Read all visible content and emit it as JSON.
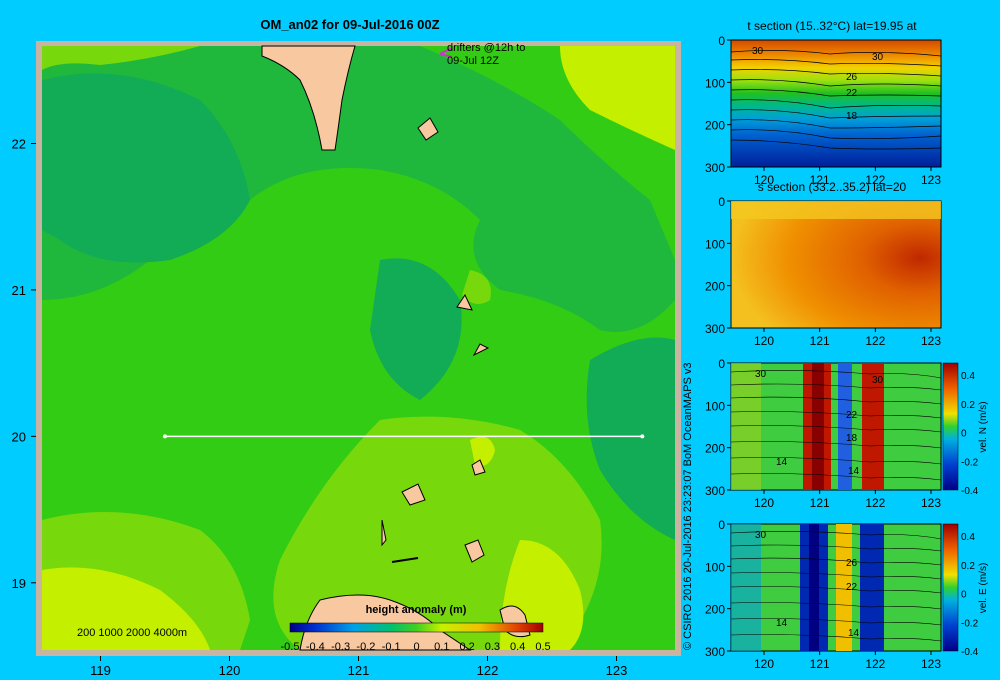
{
  "title": "OM_an02 for 09-Jul-2016 00Z",
  "credit": "© CSIRO 2016  20-Jul-2016 23:23:07 BoM OceanMAPS v3",
  "colors": {
    "background": "#00ccff",
    "land": "#f8c8a0",
    "frame": "#c8b4a0",
    "section_line": "#ffffff",
    "drifter": "#cc33cc"
  },
  "chart_data": [
    {
      "type": "heatmap",
      "name": "map",
      "title": "OM_an02 for 09-Jul-2016 00Z",
      "x_ticks": [
        119,
        120,
        121,
        122,
        123
      ],
      "y_ticks": [
        19,
        20,
        21,
        22
      ],
      "xlim": [
        118.5,
        123.5
      ],
      "ylim": [
        18.5,
        22.7
      ],
      "section_line": {
        "lat": 20,
        "lon_start": 119.5,
        "lon_end": 123.2
      },
      "drifter_note": [
        "drifters @12h to",
        "09-Jul 12Z"
      ],
      "depth_legend": "200  1000  2000  4000m",
      "colorbar": {
        "label": "height anomaly  (m)",
        "ticks": [
          "-0.5",
          "-0.4",
          "-0.3",
          "-0.2",
          "-0.1",
          "0",
          "0.1",
          "0.2",
          "0.3",
          "0.4",
          "0.5"
        ],
        "range": [
          -0.5,
          0.5
        ]
      }
    },
    {
      "type": "heatmap",
      "name": "temperature-section",
      "title": "t section (15..32°C) lat=19.95 at",
      "x_ticks": [
        "120",
        "121",
        "122",
        "123"
      ],
      "y_ticks": [
        "0",
        "100",
        "200",
        "300"
      ],
      "contour_labels": [
        "30",
        "30",
        "26",
        "22",
        "18"
      ]
    },
    {
      "type": "heatmap",
      "name": "salinity-section",
      "title": "s section (33.2..35.2) lat=20",
      "x_ticks": [
        "120",
        "121",
        "122",
        "123"
      ],
      "y_ticks": [
        "0",
        "100",
        "200",
        "300"
      ]
    },
    {
      "type": "heatmap",
      "name": "north-velocity-section",
      "x_ticks": [
        "120",
        "121",
        "122",
        "123"
      ],
      "y_ticks": [
        "0",
        "100",
        "200",
        "300"
      ],
      "contour_labels": [
        "30",
        "30",
        "22",
        "18",
        "14",
        "14"
      ],
      "colorbar": {
        "label": "vel. N (m/s)",
        "ticks": [
          "0.4",
          "0.2",
          "0",
          "-0.2",
          "-0.4"
        ],
        "range": [
          -0.4,
          0.4
        ]
      }
    },
    {
      "type": "heatmap",
      "name": "east-velocity-section",
      "x_ticks": [
        "120",
        "121",
        "122",
        "123"
      ],
      "y_ticks": [
        "0",
        "100",
        "200",
        "300"
      ],
      "contour_labels": [
        "30",
        "26",
        "22",
        "14",
        "14"
      ],
      "colorbar": {
        "label": "vel. E (m/s)",
        "ticks": [
          "0.4",
          "0.2",
          "0",
          "-0.2",
          "-0.4"
        ],
        "range": [
          -0.4,
          0.4
        ]
      }
    }
  ]
}
